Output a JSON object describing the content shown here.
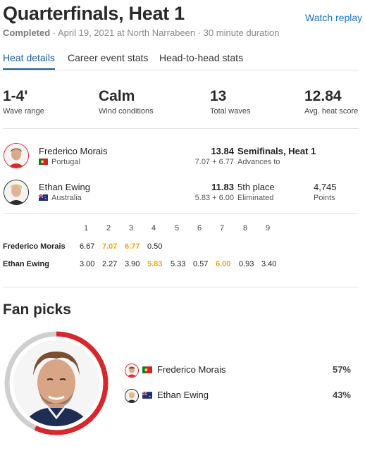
{
  "header": {
    "title": "Quarterfinals, Heat 1",
    "replay": "Watch replay",
    "status": "Completed",
    "meta": " · April 19, 2021 at North Narrabeen · 30 minute duration"
  },
  "tabs": [
    "Heat details",
    "Career event stats",
    "Head-to-head stats"
  ],
  "stats": [
    {
      "value": "1-4'",
      "label": "Wave range"
    },
    {
      "value": "Calm",
      "label": "Wind conditions"
    },
    {
      "value": "13",
      "label": "Total waves"
    },
    {
      "value": "12.84",
      "label": "Avg. heat score"
    }
  ],
  "surfers": [
    {
      "name": "Frederico Morais",
      "country": "Portugal",
      "flag": "portugal-flag-icon",
      "score": "13.84",
      "waves": "7.07 + 6.77",
      "result": "Semifinals, Heat 1",
      "result_sub": "Advances to",
      "points": "",
      "points_label": ""
    },
    {
      "name": "Ethan Ewing",
      "country": "Australia",
      "flag": "australia-flag-icon",
      "score": "11.83",
      "waves": "5.83 + 6.00",
      "result": "5th place",
      "result_sub": "Eliminated",
      "points": "4,745",
      "points_label": "Points"
    }
  ],
  "wave_grid": {
    "headers": [
      "1",
      "2",
      "3",
      "4",
      "5",
      "6",
      "7",
      "8",
      "9"
    ],
    "rows": [
      {
        "name": "Frederico Morais",
        "cells": [
          "6.67",
          "7.07",
          "6.77",
          "0.50"
        ],
        "highlight": [
          1,
          2
        ]
      },
      {
        "name": "Ethan Ewing",
        "cells": [
          "3.00",
          "2.27",
          "3.90",
          "5.83",
          "5.33",
          "0.57",
          "6.00",
          "0.93",
          "3.40"
        ],
        "highlight": [
          3,
          6
        ]
      }
    ]
  },
  "fan_picks": {
    "title": "Fan picks",
    "picks": [
      {
        "name": "Frederico Morais",
        "percent": "57%",
        "share": 0.57
      },
      {
        "name": "Ethan Ewing",
        "percent": "43%",
        "share": 0.43
      }
    ],
    "colors": {
      "leader": "#d9262c",
      "other": "#cfcfcf"
    }
  },
  "colors": {
    "accent": "#1a73c8",
    "highlight": "#f0a51c"
  }
}
